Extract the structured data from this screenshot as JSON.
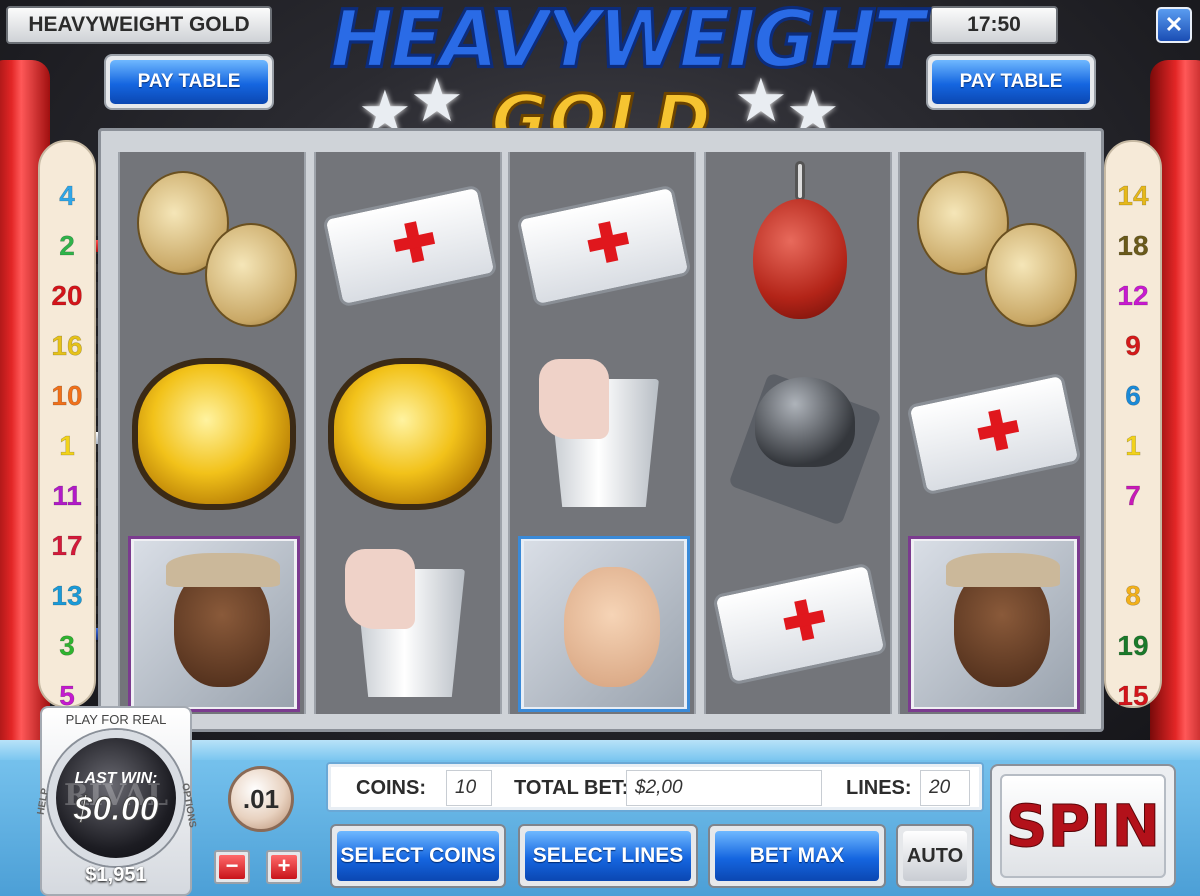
{
  "header": {
    "game_title": "HEAVYWEIGHT GOLD",
    "clock": "17:50",
    "close_glyph": "✕",
    "logo_line1": "HEAVYWEIGHT",
    "logo_line2": "GOLD",
    "pay_table_left": "PAY TABLE",
    "pay_table_right": "PAY TABLE"
  },
  "paylines": {
    "left": [
      {
        "n": "4",
        "color": "#2fa6e8"
      },
      {
        "n": "2",
        "color": "#2fb34a"
      },
      {
        "n": "20",
        "color": "#d4141a"
      },
      {
        "n": "16",
        "color": "#e6c21a"
      },
      {
        "n": "10",
        "color": "#f0701a"
      },
      {
        "n": "1",
        "color": "#f2d21a"
      },
      {
        "n": "11",
        "color": "#b21ac8"
      },
      {
        "n": "17",
        "color": "#d41a3a"
      },
      {
        "n": "13",
        "color": "#1a9ad8"
      },
      {
        "n": "3",
        "color": "#2fb32f"
      },
      {
        "n": "5",
        "color": "#c41ad0"
      }
    ],
    "right": [
      {
        "n": "14",
        "color": "#e6b81a"
      },
      {
        "n": "18",
        "color": "#6a5a1a"
      },
      {
        "n": "12",
        "color": "#c81ad0"
      },
      {
        "n": "9",
        "color": "#d41a1a"
      },
      {
        "n": "6",
        "color": "#1a8ad8"
      },
      {
        "n": "1",
        "color": "#f2d21a"
      },
      {
        "n": "7",
        "color": "#c81ab8"
      },
      {
        "n": "",
        "color": "#ffffff"
      },
      {
        "n": "8",
        "color": "#f2b01a"
      },
      {
        "n": "19",
        "color": "#1a7a2a"
      },
      {
        "n": "15",
        "color": "#d4141a"
      }
    ]
  },
  "reels": [
    [
      "dumbbell",
      "championship-belt",
      "trainer-portrait"
    ],
    [
      "first-aid-kit",
      "championship-belt",
      "water-bucket"
    ],
    [
      "first-aid-kit",
      "water-bucket",
      "referee-portrait"
    ],
    [
      "speed-bag",
      "boxing-bell",
      "first-aid-kit"
    ],
    [
      "dumbbell",
      "first-aid-kit",
      "trainer-portrait"
    ]
  ],
  "controls": {
    "play_for_real": "PLAY FOR REAL",
    "last_win_label": "LAST WIN:",
    "last_win_value": "$0.00",
    "help_label": "HELP",
    "options_label": "OPTIONS",
    "brand": "RIVAL",
    "balance": "$1,951",
    "denomination": ".01",
    "minus": "−",
    "plus": "+",
    "coins_label": "COINS:",
    "coins_value": "10",
    "total_bet_label": "TOTAL BET:",
    "total_bet_value": "$2,00",
    "lines_label": "LINES:",
    "lines_value": "20",
    "select_coins": "SELECT COINS",
    "select_lines": "SELECT LINES",
    "bet_max": "BET MAX",
    "auto": "AUTO",
    "spin": "SPIN"
  }
}
